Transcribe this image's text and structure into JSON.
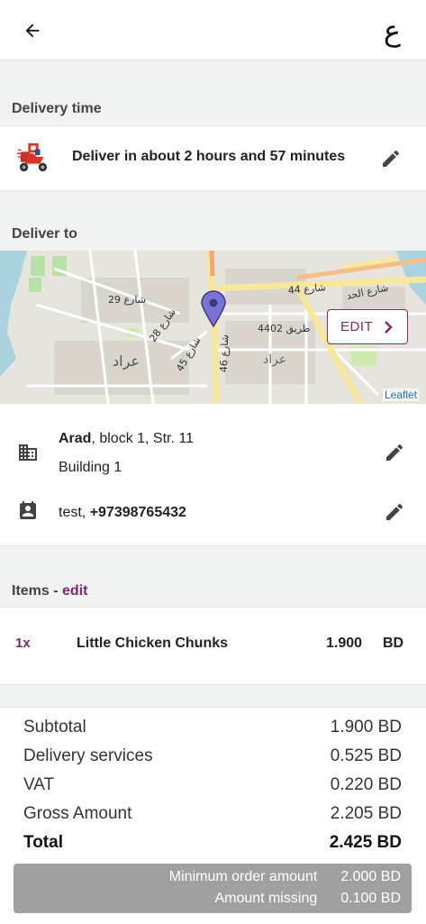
{
  "header": {
    "language_toggle": "ع"
  },
  "delivery_time": {
    "section_label": "Delivery time",
    "text": "Deliver in about 2 hours and 57 minutes"
  },
  "deliver_to": {
    "section_label": "Deliver to",
    "map": {
      "edit_label": "EDIT",
      "attribution": "Leaflet",
      "labels": {
        "street_29": "شارع 29",
        "street_28": "شارع 28",
        "street_45": "شارع 45",
        "street_46": "شارع 46",
        "street_44": "شارع 44",
        "road_4402": "طريق 4402",
        "arad_1": "عراد",
        "arad_2": "عراد",
        "street_had": "شارع الحد"
      }
    },
    "address": {
      "area": "Arad",
      "rest": ", block 1, Str. 11",
      "building": "Building 1"
    },
    "contact": {
      "name": "test, ",
      "phone": "+97398765432"
    }
  },
  "items": {
    "section_label": "Items - ",
    "edit_link": "edit",
    "list": [
      {
        "qty": "1x",
        "name": "Little Chicken Chunks",
        "price": "1.900",
        "currency": "BD"
      }
    ]
  },
  "summary": {
    "rows": [
      {
        "label": "Subtotal",
        "value": "1.900 BD"
      },
      {
        "label": "Delivery services",
        "value": "0.525 BD"
      },
      {
        "label": "VAT",
        "value": "0.220 BD"
      },
      {
        "label": "Gross Amount",
        "value": "2.205 BD"
      }
    ],
    "total": {
      "label": "Total",
      "value": "2.425 BD"
    },
    "minimum_order": {
      "label": "Minimum order amount",
      "value": "2.000 BD"
    },
    "amount_missing": {
      "label": "Amount missing",
      "value": "0.100 BD"
    }
  },
  "colors": {
    "accent": "#7b2a6a",
    "pin": "#7a73d6",
    "map_road": "#f7e9a0"
  }
}
